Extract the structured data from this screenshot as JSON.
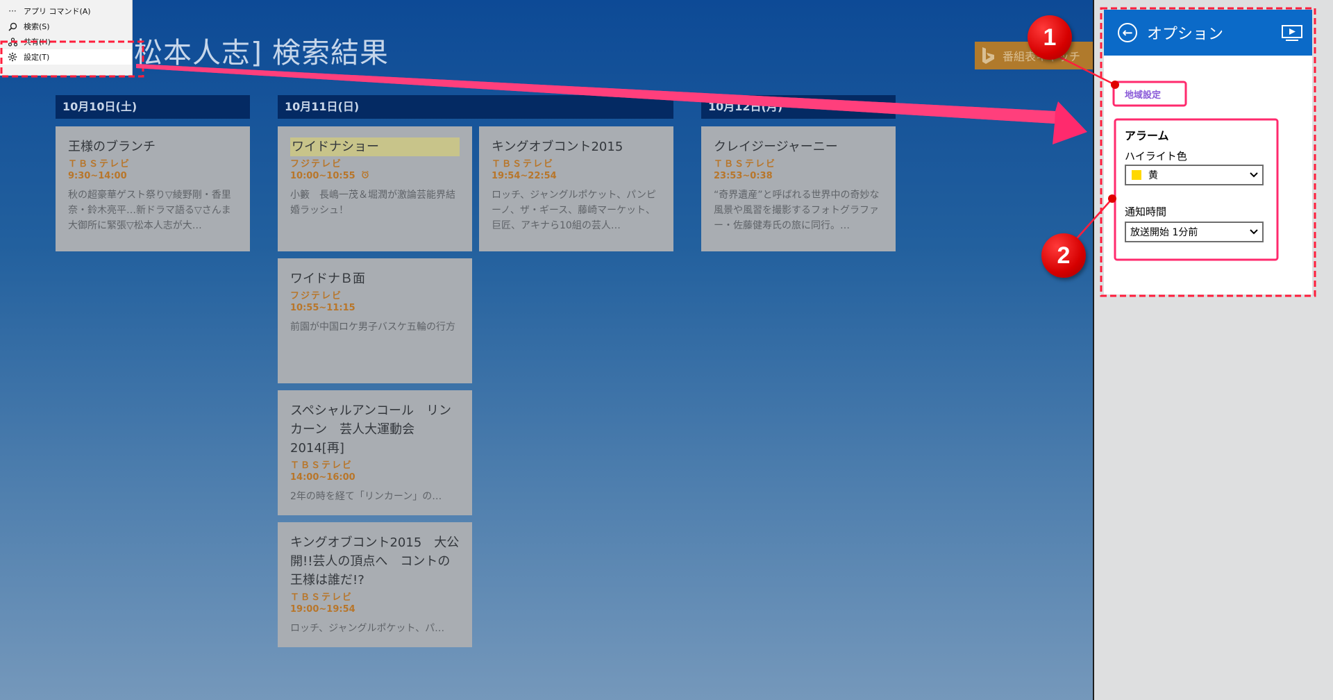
{
  "page": {
    "title": "[松本人志] 検索結果"
  },
  "bing_badge": {
    "text": "番組表キャッチ"
  },
  "app_menu": {
    "items": [
      {
        "icon": "more-icon",
        "label": "アプリ コマンド(A)"
      },
      {
        "icon": "search-icon",
        "label": "検索(S)"
      },
      {
        "icon": "share-icon",
        "label": "共有(H)"
      },
      {
        "icon": "gear-icon",
        "label": "設定(T)"
      }
    ],
    "selected_index": 3
  },
  "dates": [
    "10月10日(土)",
    "10月11日(日)",
    "10月12日(月)"
  ],
  "cards": [
    {
      "title": "王様のブランチ",
      "channel": "ＴＢＳテレビ",
      "time": "9:30~14:00",
      "desc": "秋の超豪華ゲスト祭り▽綾野剛・香里奈・鈴木亮平…新ドラマ語る▽さんま大御所に緊張▽松本人志が大…",
      "highlight": false,
      "alarm": false
    },
    {
      "title": "ワイドナショー",
      "channel": "フジテレビ",
      "time": "10:00~10:55",
      "desc": "小籔　長嶋一茂＆堀潤が激論芸能界結婚ラッシュ！",
      "highlight": true,
      "alarm": true
    },
    {
      "title": "ワイドナＢ面",
      "channel": "フジテレビ",
      "time": "10:55~11:15",
      "desc": "前園が中国ロケ男子バスケ五輪の行方",
      "highlight": false,
      "alarm": false
    },
    {
      "title": "スペシャルアンコール　リンカーン　芸人大運動会2014[再]",
      "channel": "ＴＢＳテレビ",
      "time": "14:00~16:00",
      "desc": "2年の時を経て「リンカーン」の…",
      "highlight": false,
      "alarm": false
    },
    {
      "title": "キングオブコント2015　大公開!!芸人の頂点へ　コントの王様は誰だ!?",
      "channel": "ＴＢＳテレビ",
      "time": "19:00~19:54",
      "desc": "ロッチ、ジャングルポケット、パ…",
      "highlight": false,
      "alarm": false
    },
    {
      "title": "キングオブコント2015",
      "channel": "ＴＢＳテレビ",
      "time": "19:54~22:54",
      "desc": "ロッチ、ジャングルポケット、パンピーノ、ザ・ギース、藤崎マーケット、巨匠、アキナら10組の芸人…",
      "highlight": false,
      "alarm": false
    },
    {
      "title": "クレイジージャーニー",
      "channel": "ＴＢＳテレビ",
      "time": "23:53~0:38",
      "desc": "“奇界遺産”と呼ばれる世界中の奇妙な風景や風習を撮影するフォトグラファー・佐藤健寿氏の旅に同行。…",
      "highlight": false,
      "alarm": false
    }
  ],
  "options": {
    "title": "オプション",
    "region_link": "地域設定",
    "alarm_heading": "アラーム",
    "highlight_label": "ハイライト色",
    "highlight_value": "黄",
    "highlight_color": "#ffd800",
    "notify_label": "通知時間",
    "notify_value": "放送開始 1分前"
  },
  "annotations": {
    "badge_1": "1",
    "badge_2": "2"
  },
  "colors": {
    "annotation": "#ff2a6d",
    "accent": "#0b6ac8",
    "card_channel": "#b8762a"
  }
}
